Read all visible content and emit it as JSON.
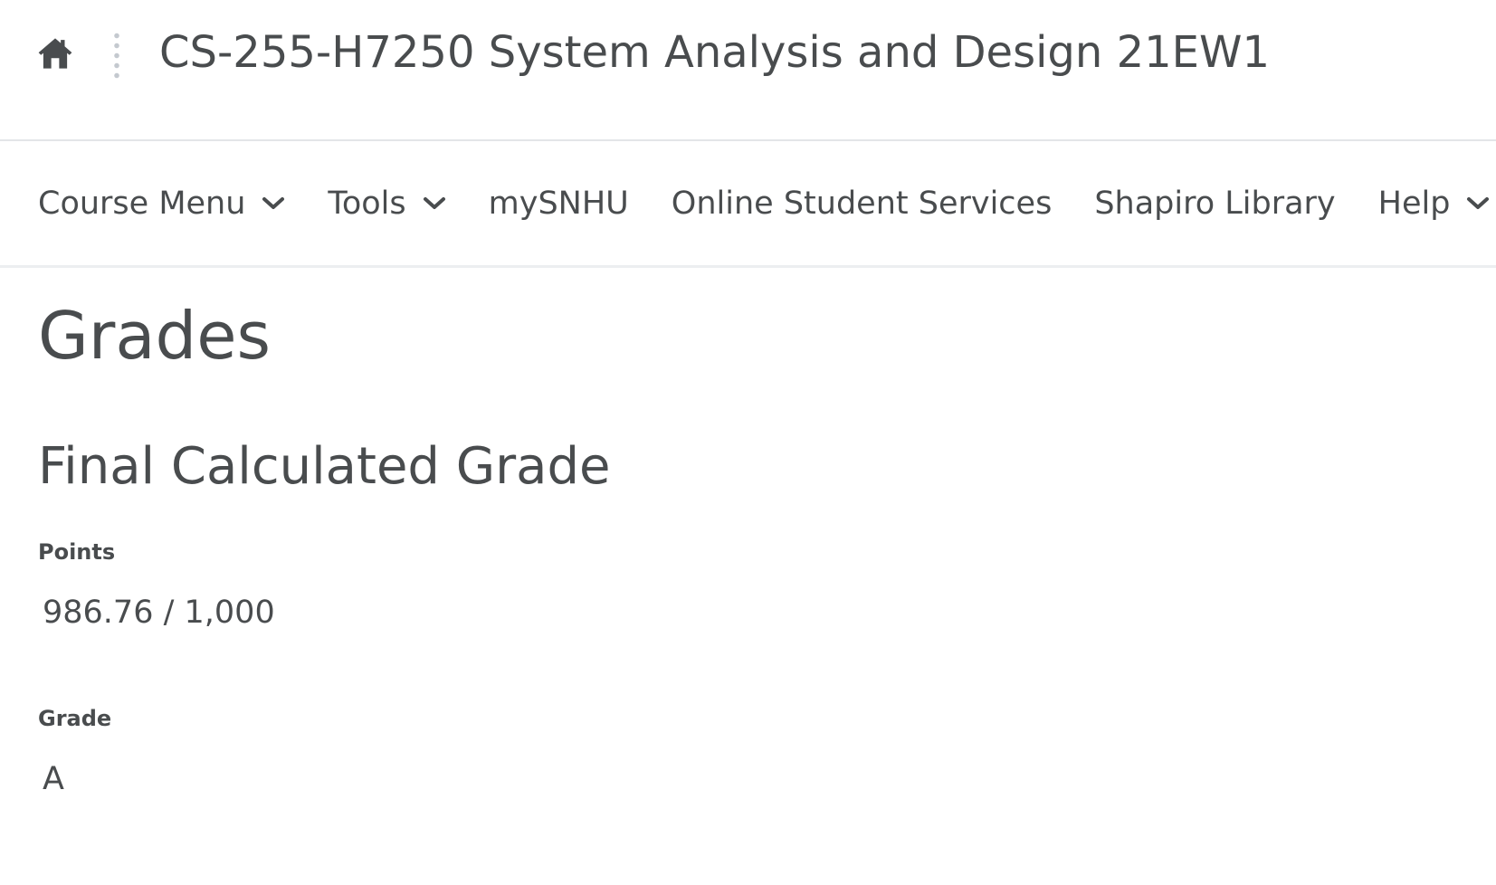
{
  "header": {
    "home_icon": "home-icon",
    "course_title": "CS-255-H7250 System Analysis and Design 21EW1"
  },
  "nav": {
    "items": [
      {
        "label": "Course Menu",
        "has_dropdown": true
      },
      {
        "label": "Tools",
        "has_dropdown": true
      },
      {
        "label": "mySNHU",
        "has_dropdown": false
      },
      {
        "label": "Online Student Services",
        "has_dropdown": false
      },
      {
        "label": "Shapiro Library",
        "has_dropdown": false
      },
      {
        "label": "Help",
        "has_dropdown": true
      }
    ]
  },
  "main": {
    "page_title": "Grades",
    "section_title": "Final Calculated Grade",
    "points_label": "Points",
    "points_value": "986.76 / 1,000",
    "grade_label": "Grade",
    "grade_value": "A"
  },
  "colors": {
    "text": "#494c4e",
    "divider": "#e3e5e8",
    "background": "#ffffff"
  }
}
